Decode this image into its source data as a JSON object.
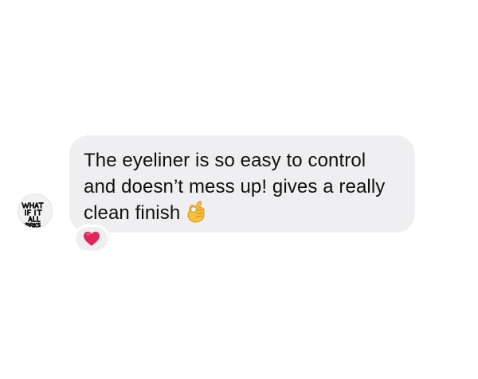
{
  "conversation": {
    "message": {
      "text": "The eyeliner is so easy to control and doesn’t mess up! gives a really clean finish",
      "emoji": "ok-hand-icon"
    },
    "avatar": {
      "logo_text": "WHAT IF IT ALL WORKS"
    },
    "reaction": {
      "icon": "red-heart-icon",
      "color": "#e0245e"
    }
  },
  "colors": {
    "background": "#ffffff",
    "bubble": "#efeff1",
    "text": "#101010"
  }
}
